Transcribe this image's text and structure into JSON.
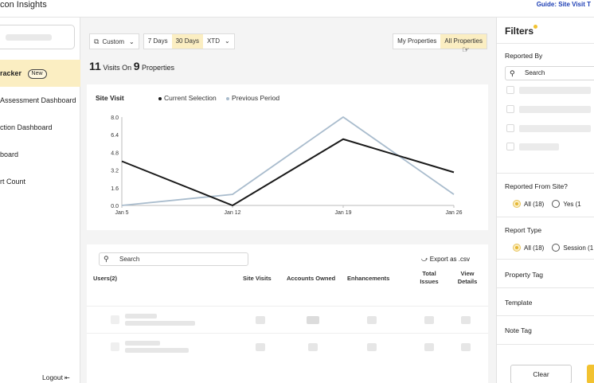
{
  "header": {
    "app_title": "con Insights",
    "guide_link": "Guide: Site Visit T"
  },
  "sidebar": {
    "items": [
      {
        "label": "racker",
        "badge": "New"
      },
      {
        "label": "Assessment Dashboard"
      },
      {
        "label": "ction Dashboard"
      },
      {
        "label": "board"
      },
      {
        "label": "rt Count"
      }
    ],
    "logout": "Logout"
  },
  "controls": {
    "range_select": "Custom",
    "range_options": [
      "7 Days",
      "30 Days",
      "XTD"
    ],
    "selected_range": "30 Days",
    "property_toggle": [
      "My Properties",
      "All Properties"
    ],
    "selected_property": "All Properties"
  },
  "summary": {
    "visits": "11",
    "visits_text": "Visits On",
    "properties": "9",
    "properties_text": "Properties"
  },
  "chart_data": {
    "type": "line",
    "title": "Site Visit",
    "categories": [
      "Jan 5",
      "Jan 12",
      "Jan 19",
      "Jan 26"
    ],
    "series": [
      {
        "name": "Current Selection",
        "values": [
          4,
          0,
          6,
          3
        ],
        "color": "#1a1a1a"
      },
      {
        "name": "Previous Period",
        "values": [
          0,
          1,
          8,
          1
        ],
        "color": "#a9bccd"
      }
    ],
    "ylim": [
      0,
      8
    ],
    "yticks": [
      "8.0",
      "6.4",
      "4.8",
      "3.2",
      "1.6",
      "0.0"
    ],
    "grid": false,
    "legend": "top-left"
  },
  "table": {
    "search_placeholder": "Search",
    "export_label": "Export as .csv",
    "columns": [
      "Users(2)",
      "Site Visits",
      "Accounts Owned",
      "Enhancements",
      "Total Issues",
      "View Details"
    ]
  },
  "filters": {
    "title": "Filters",
    "reported_by": "Reported By",
    "search_placeholder": "Search",
    "reported_from_site": "Reported From Site?",
    "site_options": [
      "All (18)",
      "Yes (1"
    ],
    "report_type": "Report Type",
    "report_type_options": [
      "All (18)",
      "Session (1"
    ],
    "property_tag": "Property Tag",
    "template": "Template",
    "note_tag": "Note Tag",
    "clear_label": "Clear"
  },
  "colors": {
    "accent": "#fbeec2",
    "accent_strong": "#f2c230",
    "link": "#1e3fb5"
  }
}
